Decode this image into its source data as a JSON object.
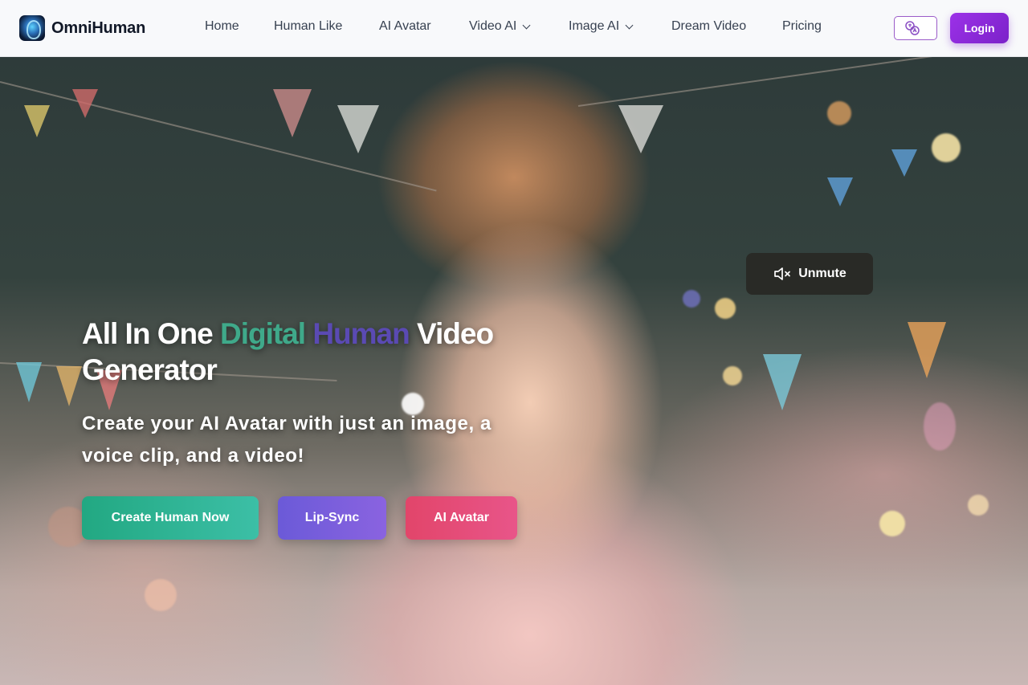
{
  "brand": {
    "name": "OmniHuman",
    "logo_icon": "brain-head-icon"
  },
  "nav": {
    "items": [
      {
        "label": "Home",
        "has_dropdown": false
      },
      {
        "label": "Human Like",
        "has_dropdown": false
      },
      {
        "label": "AI Avatar",
        "has_dropdown": false
      },
      {
        "label": "Video AI",
        "has_dropdown": true
      },
      {
        "label": "Image AI",
        "has_dropdown": true
      },
      {
        "label": "Dream Video",
        "has_dropdown": false
      },
      {
        "label": "Pricing",
        "has_dropdown": false
      }
    ]
  },
  "header": {
    "language_icon": "translate-icon",
    "login_label": "Login"
  },
  "hero": {
    "unmute_label": "Unmute",
    "unmute_icon": "speaker-muted-icon",
    "headline": {
      "part1": "All In One ",
      "highlight1": "Digital",
      "space": " ",
      "highlight2": "Human",
      "part2": " Video Generator"
    },
    "subheadline": "Create your AI Avatar with just an image, a voice clip, and a video!",
    "buttons": {
      "create": "Create Human Now",
      "lipsync": "Lip-Sync",
      "avatar": "AI Avatar"
    }
  },
  "colors": {
    "accent_purple": "#7b22c9",
    "highlight_green": "#3fa98a",
    "highlight_purple": "#5a4ab3",
    "cta_green": "#22a882",
    "cta_purple": "#6b5ad8",
    "cta_red": "#e2456a"
  }
}
